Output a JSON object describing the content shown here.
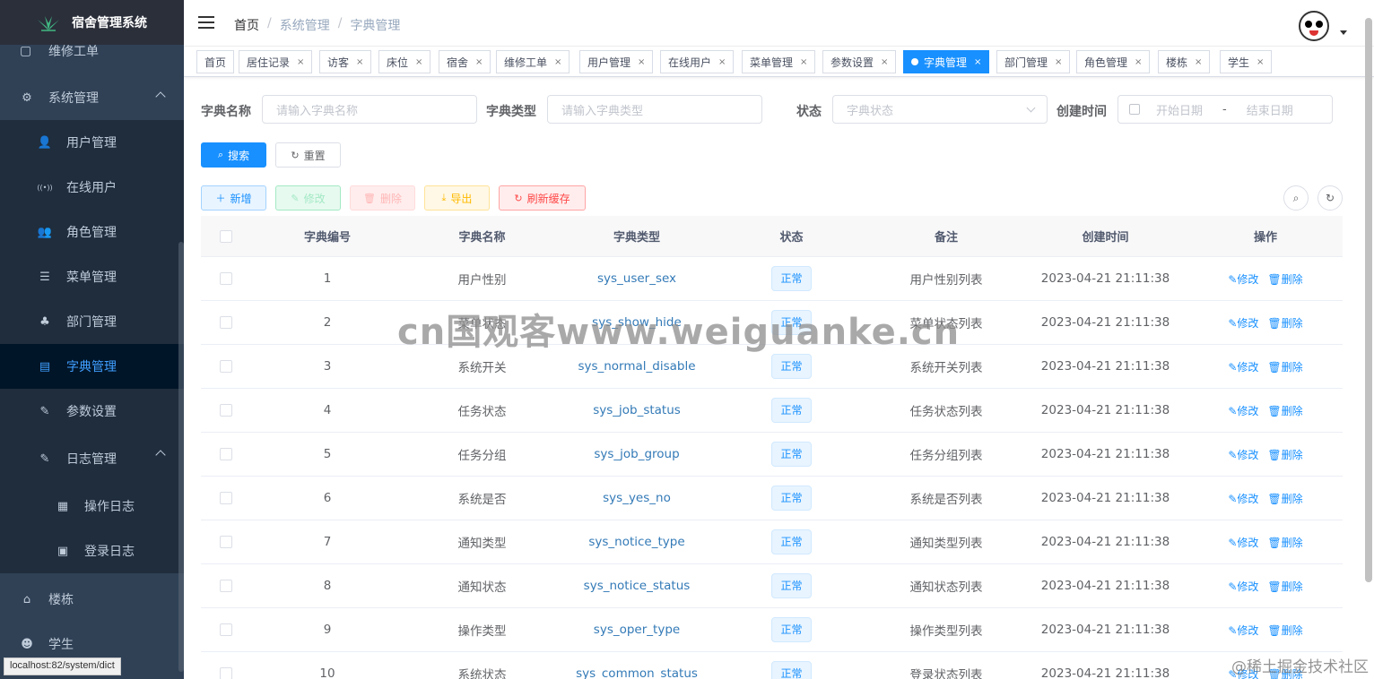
{
  "app": {
    "title": "宿舍管理系统"
  },
  "sidebar": {
    "partial_top": "维修工单",
    "items": [
      {
        "label": "系统管理",
        "icon": "gear-icon",
        "level": 1,
        "expanded": true
      },
      {
        "label": "用户管理",
        "icon": "user-icon",
        "level": 2
      },
      {
        "label": "在线用户",
        "icon": "online-icon",
        "level": 2
      },
      {
        "label": "角色管理",
        "icon": "peoples-icon",
        "level": 2
      },
      {
        "label": "菜单管理",
        "icon": "tree-table-icon",
        "level": 2
      },
      {
        "label": "部门管理",
        "icon": "tree-icon",
        "level": 2
      },
      {
        "label": "字典管理",
        "icon": "dict-icon",
        "level": 2,
        "active": true
      },
      {
        "label": "参数设置",
        "icon": "edit-icon",
        "level": 2
      },
      {
        "label": "日志管理",
        "icon": "log-icon",
        "level": 2,
        "expanded": true
      },
      {
        "label": "操作日志",
        "icon": "form-icon",
        "level": 3
      },
      {
        "label": "登录日志",
        "icon": "logininfor-icon",
        "level": 3
      },
      {
        "label": "楼栋",
        "icon": "building-icon",
        "level": 1
      },
      {
        "label": "学生",
        "icon": "student-icon",
        "level": 1
      }
    ],
    "status_url": "localhost:82/system/dict"
  },
  "navbar": {
    "breadcrumb": [
      "首页",
      "系统管理",
      "字典管理"
    ]
  },
  "tags": [
    {
      "label": "首页",
      "closable": false
    },
    {
      "label": "居住记录",
      "closable": true
    },
    {
      "label": "访客",
      "closable": true
    },
    {
      "label": "床位",
      "closable": true
    },
    {
      "label": "宿舍",
      "closable": true
    },
    {
      "label": "维修工单",
      "closable": true
    },
    {
      "label": "用户管理",
      "closable": true
    },
    {
      "label": "在线用户",
      "closable": true
    },
    {
      "label": "菜单管理",
      "closable": true
    },
    {
      "label": "参数设置",
      "closable": true
    },
    {
      "label": "字典管理",
      "closable": true,
      "active": true
    },
    {
      "label": "部门管理",
      "closable": true
    },
    {
      "label": "角色管理",
      "closable": true
    },
    {
      "label": "楼栋",
      "closable": true
    },
    {
      "label": "学生",
      "closable": true
    }
  ],
  "search": {
    "dict_name_label": "字典名称",
    "dict_name_placeholder": "请输入字典名称",
    "dict_type_label": "字典类型",
    "dict_type_placeholder": "请输入字典类型",
    "status_label": "状态",
    "status_placeholder": "字典状态",
    "created_label": "创建时间",
    "start_placeholder": "开始日期",
    "range_sep": "-",
    "end_placeholder": "结束日期",
    "search_btn": "搜索",
    "reset_btn": "重置"
  },
  "toolbar": {
    "add": "新增",
    "edit": "修改",
    "delete": "删除",
    "export": "导出",
    "refresh_cache": "刷新缓存"
  },
  "table": {
    "headers": [
      "字典编号",
      "字典名称",
      "字典类型",
      "状态",
      "备注",
      "创建时间",
      "操作"
    ],
    "rows": [
      {
        "id": "1",
        "name": "用户性别",
        "type": "sys_user_sex",
        "status": "正常",
        "remark": "用户性别列表",
        "created": "2023-04-21 21:11:38"
      },
      {
        "id": "2",
        "name": "菜单状态",
        "type": "sys_show_hide",
        "status": "正常",
        "remark": "菜单状态列表",
        "created": "2023-04-21 21:11:38"
      },
      {
        "id": "3",
        "name": "系统开关",
        "type": "sys_normal_disable",
        "status": "正常",
        "remark": "系统开关列表",
        "created": "2023-04-21 21:11:38"
      },
      {
        "id": "4",
        "name": "任务状态",
        "type": "sys_job_status",
        "status": "正常",
        "remark": "任务状态列表",
        "created": "2023-04-21 21:11:38"
      },
      {
        "id": "5",
        "name": "任务分组",
        "type": "sys_job_group",
        "status": "正常",
        "remark": "任务分组列表",
        "created": "2023-04-21 21:11:38"
      },
      {
        "id": "6",
        "name": "系统是否",
        "type": "sys_yes_no",
        "status": "正常",
        "remark": "系统是否列表",
        "created": "2023-04-21 21:11:38"
      },
      {
        "id": "7",
        "name": "通知类型",
        "type": "sys_notice_type",
        "status": "正常",
        "remark": "通知类型列表",
        "created": "2023-04-21 21:11:38"
      },
      {
        "id": "8",
        "name": "通知状态",
        "type": "sys_notice_status",
        "status": "正常",
        "remark": "通知状态列表",
        "created": "2023-04-21 21:11:38"
      },
      {
        "id": "9",
        "name": "操作类型",
        "type": "sys_oper_type",
        "status": "正常",
        "remark": "操作类型列表",
        "created": "2023-04-21 21:11:38"
      },
      {
        "id": "10",
        "name": "系统状态",
        "type": "sys_common_status",
        "status": "正常",
        "remark": "登录状态列表",
        "created": "2023-04-21 21:11:38"
      }
    ],
    "op_edit": "修改",
    "op_delete": "删除"
  },
  "watermark": "cn国观客www.weiguanke.cn",
  "credit": "@稀土掘金技术社区"
}
